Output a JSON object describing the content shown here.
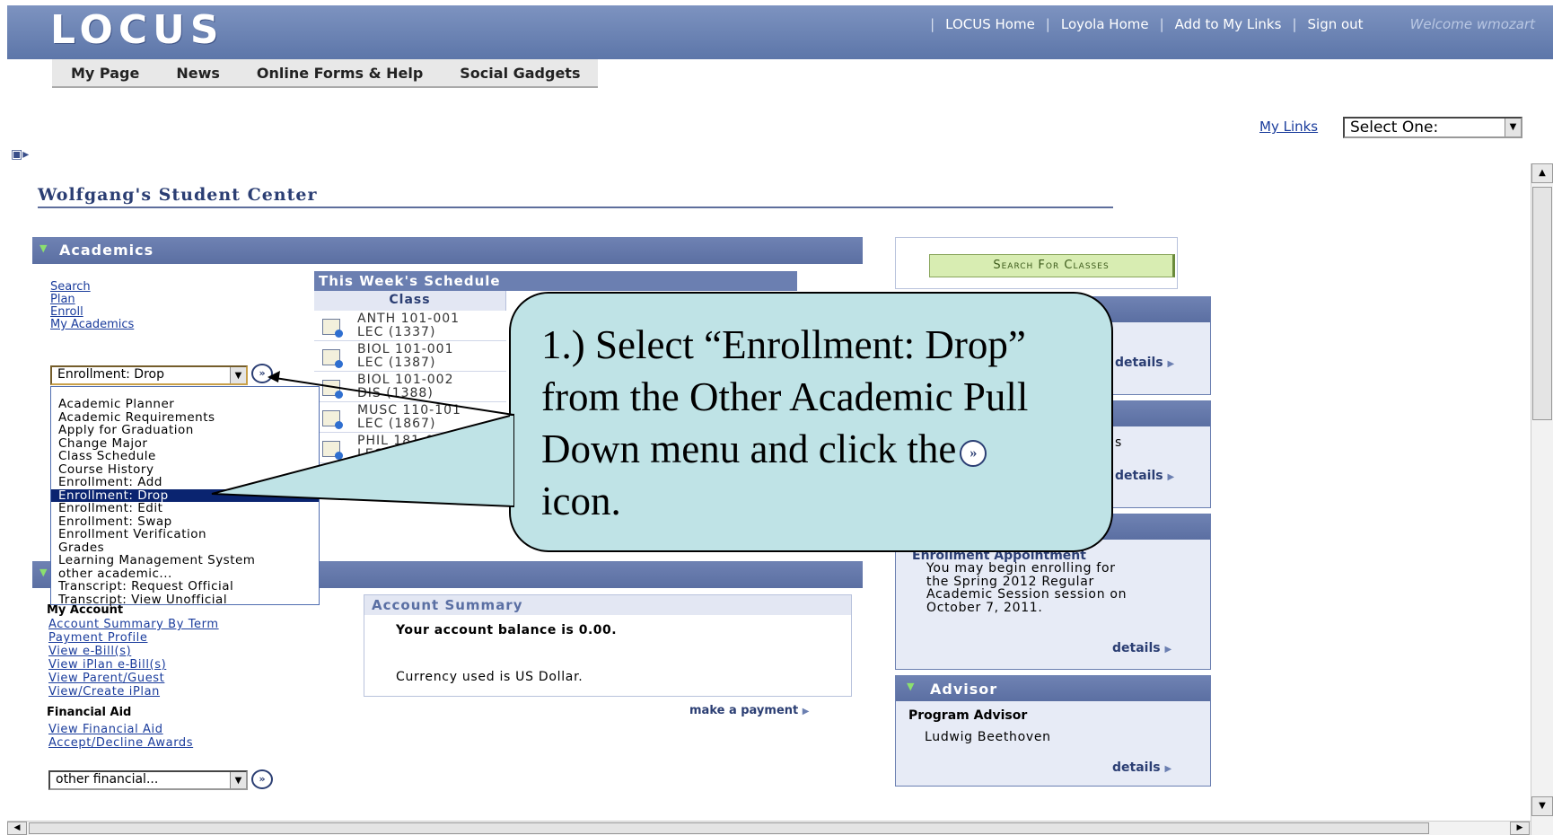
{
  "header": {
    "logo": "LOCUS",
    "links": [
      "LOCUS Home",
      "Loyola Home",
      "Add to My Links",
      "Sign out"
    ],
    "welcome": "Welcome wmozart"
  },
  "tabs": [
    "My Page",
    "News",
    "Online Forms & Help",
    "Social Gadgets"
  ],
  "my_links": {
    "label": "My Links",
    "selected": "Select One:"
  },
  "page_title": "Wolfgang's Student Center",
  "academics": {
    "title": "Academics",
    "links": [
      "Search",
      "Plan",
      "Enroll",
      "My Academics"
    ],
    "dropdown_selected": "Enrollment: Drop",
    "options": [
      "Academic Planner",
      "Academic Requirements",
      "Apply for Graduation",
      "Change Major",
      "Class Schedule",
      "Course History",
      "Enrollment: Add",
      "Enrollment: Drop",
      "Enrollment: Edit",
      "Enrollment: Swap",
      "Enrollment Verification",
      "Grades",
      "Learning Management System",
      "other academic...",
      "Transcript: Request Official",
      "Transcript: View Unofficial"
    ]
  },
  "schedule": {
    "title": "This Week's Schedule",
    "column": "Class",
    "rows": [
      {
        "l1": "ANTH 101-001",
        "l2": "LEC (1337)"
      },
      {
        "l1": "BIOL 101-001",
        "l2": "LEC (1387)"
      },
      {
        "l1": "BIOL 101-002",
        "l2": "DIS (1388)"
      },
      {
        "l1": "MUSC 110-101",
        "l2": "LEC (1867)"
      },
      {
        "l1": "PHIL 181-003",
        "l2": "LEC (4..."
      }
    ]
  },
  "search_button": "Search For Classes",
  "right": {
    "details": "details",
    "partial_s": "s",
    "appointment_title": "Enrollment Appointment",
    "appointment_text": [
      "You may begin enrolling for",
      "the Spring 2012 Regular",
      "Academic Session session on",
      "October 7, 2011."
    ],
    "advisor_title": "Advisor",
    "advisor_role": "Program Advisor",
    "advisor_name": "Ludwig Beethoven"
  },
  "finances": {
    "my_account_label": "My Account",
    "account_links": [
      "Account Summary By Term",
      "Payment Profile",
      "View e-Bill(s)",
      "View iPlan e-Bill(s)",
      "View Parent/Guest",
      "View/Create iPlan"
    ],
    "financial_aid_label": "Financial Aid",
    "aid_links": [
      "View Financial Aid",
      "Accept/Decline Awards"
    ],
    "other_dropdown": "other financial...",
    "summary_title": "Account Summary",
    "balance": "Your account balance is 0.00.",
    "currency": "Currency used is US Dollar.",
    "make_payment": "make a payment"
  },
  "callout": {
    "line1": "1.) Select “Enrollment: Drop”",
    "line2": "from the Other Academic Pull",
    "line3": "Down menu and click the",
    "line4": "icon."
  }
}
